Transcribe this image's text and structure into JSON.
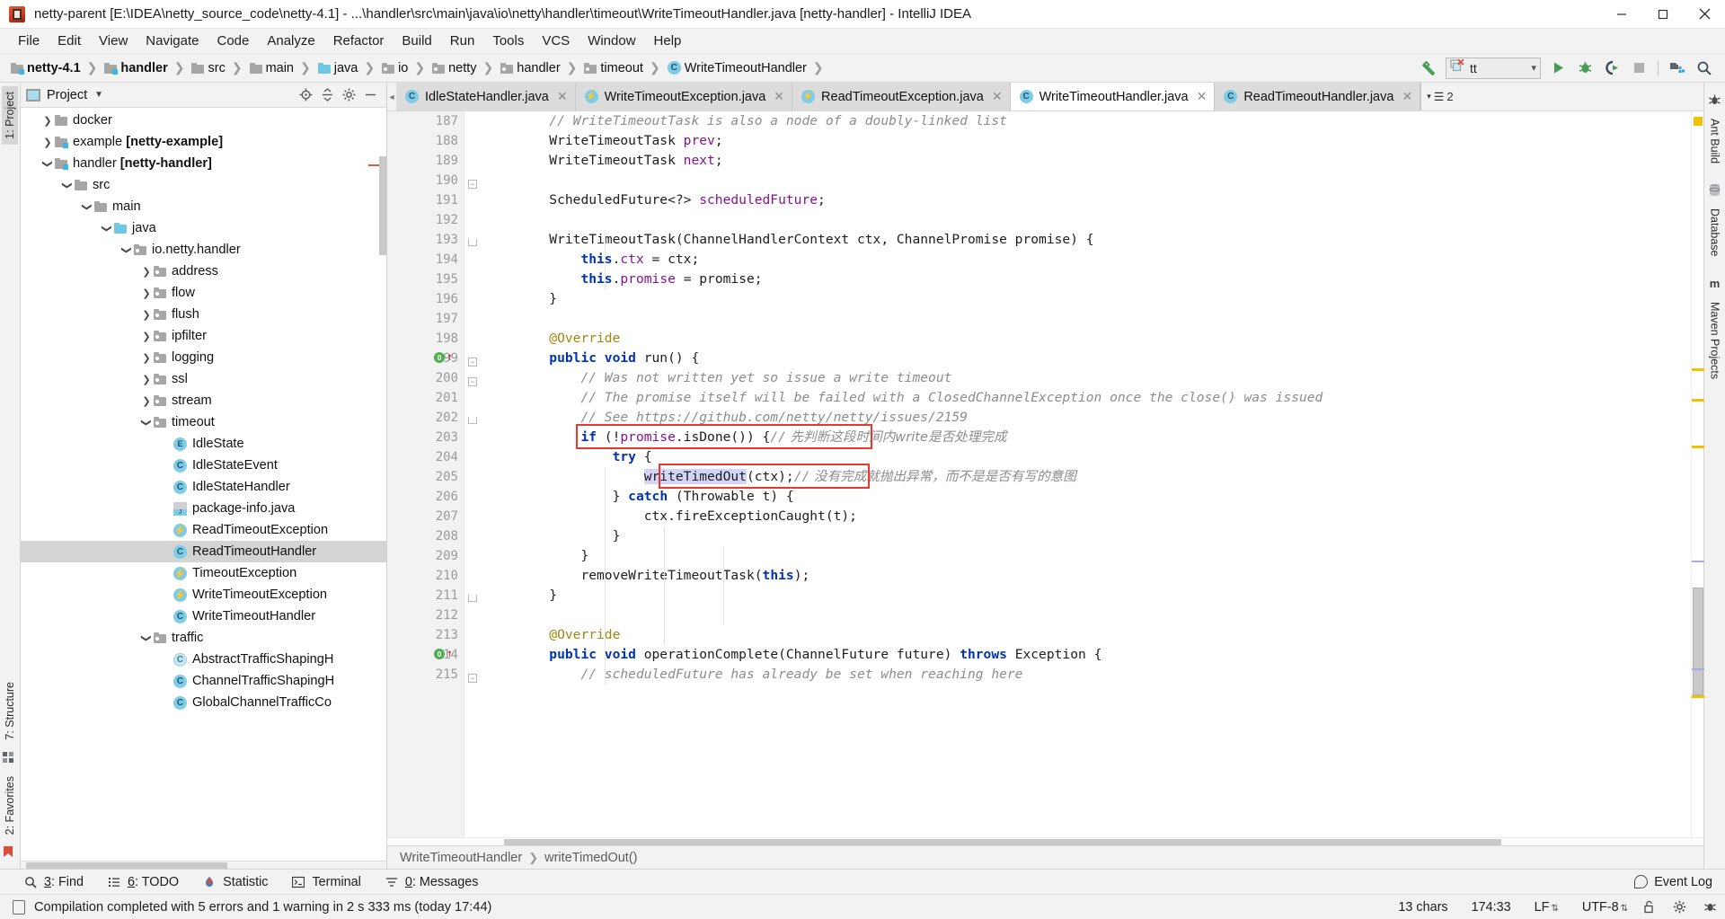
{
  "window": {
    "title": "netty-parent [E:\\IDEA\\netty_source_code\\netty-4.1] - ...\\handler\\src\\main\\java\\io\\netty\\handler\\timeout\\WriteTimeoutHandler.java [netty-handler] - IntelliJ IDEA",
    "minimize_label": "minimize-icon",
    "maximize_label": "maximize-icon",
    "close_label": "close-icon"
  },
  "menubar": {
    "items": [
      "File",
      "Edit",
      "View",
      "Navigate",
      "Code",
      "Analyze",
      "Refactor",
      "Build",
      "Run",
      "Tools",
      "VCS",
      "Window",
      "Help"
    ]
  },
  "navbar": {
    "breadcrumbs": [
      {
        "label": "netty-4.1",
        "icon": "module-folder-icon",
        "bold": true
      },
      {
        "label": "handler",
        "icon": "module-folder-icon",
        "bold": true
      },
      {
        "label": "src",
        "icon": "folder-icon",
        "bold": false
      },
      {
        "label": "main",
        "icon": "folder-icon",
        "bold": false
      },
      {
        "label": "java",
        "icon": "source-folder-icon",
        "bold": false
      },
      {
        "label": "io",
        "icon": "package-icon",
        "bold": false
      },
      {
        "label": "netty",
        "icon": "package-icon",
        "bold": false
      },
      {
        "label": "handler",
        "icon": "package-icon",
        "bold": false
      },
      {
        "label": "timeout",
        "icon": "package-icon",
        "bold": false
      },
      {
        "label": "WriteTimeoutHandler",
        "icon": "class-icon",
        "bold": false
      }
    ],
    "run_config": "tt",
    "buttons": [
      "build-hammer-icon",
      "run-icon",
      "debug-icon",
      "run-with-coverage-icon",
      "stop-icon",
      "project-structure-icon",
      "search-everywhere-icon"
    ]
  },
  "project_panel": {
    "title": "Project",
    "header_buttons": [
      "locate-icon",
      "collapse-all-icon",
      "settings-gear-icon",
      "hide-icon"
    ],
    "tree": [
      {
        "label": "docker",
        "indent": 1,
        "twist": "collapsed",
        "icon": "folder-icon",
        "selected": false
      },
      {
        "label": "example ",
        "bold_suffix": "[netty-example]",
        "indent": 1,
        "twist": "collapsed",
        "icon": "module-folder-icon",
        "selected": false
      },
      {
        "label": "handler ",
        "bold_suffix": "[netty-handler]",
        "indent": 1,
        "twist": "expanded",
        "icon": "module-folder-icon",
        "selected": false
      },
      {
        "label": "src",
        "indent": 2,
        "twist": "expanded",
        "icon": "folder-icon",
        "selected": false
      },
      {
        "label": "main",
        "indent": 3,
        "twist": "expanded",
        "icon": "folder-icon",
        "selected": false
      },
      {
        "label": "java",
        "indent": 4,
        "twist": "expanded",
        "icon": "source-folder-icon",
        "selected": false
      },
      {
        "label": "io.netty.handler",
        "indent": 5,
        "twist": "expanded",
        "icon": "package-icon",
        "selected": false
      },
      {
        "label": "address",
        "indent": 6,
        "twist": "collapsed",
        "icon": "package-icon",
        "selected": false
      },
      {
        "label": "flow",
        "indent": 6,
        "twist": "collapsed",
        "icon": "package-icon",
        "selected": false
      },
      {
        "label": "flush",
        "indent": 6,
        "twist": "collapsed",
        "icon": "package-icon",
        "selected": false
      },
      {
        "label": "ipfilter",
        "indent": 6,
        "twist": "collapsed",
        "icon": "package-icon",
        "selected": false
      },
      {
        "label": "logging",
        "indent": 6,
        "twist": "collapsed",
        "icon": "package-icon",
        "selected": false
      },
      {
        "label": "ssl",
        "indent": 6,
        "twist": "collapsed",
        "icon": "package-icon",
        "selected": false
      },
      {
        "label": "stream",
        "indent": 6,
        "twist": "collapsed",
        "icon": "package-icon",
        "selected": false
      },
      {
        "label": "timeout",
        "indent": 6,
        "twist": "expanded",
        "icon": "package-icon",
        "selected": false
      },
      {
        "label": "IdleState",
        "indent": 7,
        "twist": "none",
        "icon": "enum-icon",
        "selected": false
      },
      {
        "label": "IdleStateEvent",
        "indent": 7,
        "twist": "none",
        "icon": "class-icon",
        "selected": false
      },
      {
        "label": "IdleStateHandler",
        "indent": 7,
        "twist": "none",
        "icon": "class-icon",
        "selected": false
      },
      {
        "label": "package-info.java",
        "indent": 7,
        "twist": "none",
        "icon": "java-file-icon",
        "selected": false
      },
      {
        "label": "ReadTimeoutException",
        "indent": 7,
        "twist": "none",
        "icon": "exception-class-icon",
        "selected": false
      },
      {
        "label": "ReadTimeoutHandler",
        "indent": 7,
        "twist": "none",
        "icon": "class-icon",
        "selected": true
      },
      {
        "label": "TimeoutException",
        "indent": 7,
        "twist": "none",
        "icon": "exception-icon",
        "selected": false
      },
      {
        "label": "WriteTimeoutException",
        "indent": 7,
        "twist": "none",
        "icon": "exception-class-icon",
        "selected": false
      },
      {
        "label": "WriteTimeoutHandler",
        "indent": 7,
        "twist": "none",
        "icon": "class-icon",
        "selected": false
      },
      {
        "label": "traffic",
        "indent": 6,
        "twist": "expanded",
        "icon": "package-icon",
        "selected": false
      },
      {
        "label": "AbstractTrafficShapingH",
        "indent": 7,
        "twist": "none",
        "icon": "abstract-class-icon",
        "selected": false
      },
      {
        "label": "ChannelTrafficShapingH",
        "indent": 7,
        "twist": "none",
        "icon": "class-icon",
        "selected": false
      },
      {
        "label": "GlobalChannelTrafficCo",
        "indent": 7,
        "twist": "none",
        "icon": "class-icon",
        "selected": false
      }
    ]
  },
  "left_strip": {
    "top_tabs": [
      "1: Project"
    ],
    "bottom_tabs": [
      "7: Structure",
      "2: Favorites"
    ]
  },
  "right_strip": {
    "tabs": [
      "Ant Build",
      "Database",
      "Maven Projects"
    ]
  },
  "editor_tabs": [
    {
      "label": "IdleStateHandler.java",
      "icon": "class-icon",
      "active": false
    },
    {
      "label": "WriteTimeoutException.java",
      "icon": "exception-class-icon",
      "active": false
    },
    {
      "label": "ReadTimeoutException.java",
      "icon": "exception-class-icon",
      "active": false
    },
    {
      "label": "WriteTimeoutHandler.java",
      "icon": "class-icon",
      "active": true
    },
    {
      "label": "ReadTimeoutHandler.java",
      "icon": "class-icon",
      "active": false
    }
  ],
  "editor_tabs_overflow": "2",
  "code": {
    "first_line": 187,
    "lines": [
      {
        "n": 187,
        "html": "        <span class='cm'>// WriteTimeoutTask is also a node of a doubly-linked list</span>"
      },
      {
        "n": 188,
        "html": "        <span class='tx'>WriteTimeoutTask </span><span class='fl'>prev</span><span class='tx'>;</span>"
      },
      {
        "n": 189,
        "html": "        <span class='tx'>WriteTimeoutTask </span><span class='fl'>next</span><span class='tx'>;</span>"
      },
      {
        "n": 190,
        "html": ""
      },
      {
        "n": 191,
        "html": "        <span class='tx'>ScheduledFuture&lt;?&gt; </span><span class='fl'>scheduledFuture</span><span class='tx'>;</span>"
      },
      {
        "n": 192,
        "html": ""
      },
      {
        "n": 193,
        "html": "        <span class='tx'>WriteTimeoutTask(ChannelHandlerContext ctx, ChannelPromise promise) {</span>"
      },
      {
        "n": 194,
        "html": "            <span class='k'>this</span><span class='tx'>.</span><span class='fl'>ctx</span><span class='tx'> = ctx;</span>"
      },
      {
        "n": 195,
        "html": "            <span class='k'>this</span><span class='tx'>.</span><span class='fl'>promise</span><span class='tx'> = promise;</span>"
      },
      {
        "n": 196,
        "html": "        <span class='tx'>}</span>"
      },
      {
        "n": 197,
        "html": ""
      },
      {
        "n": 198,
        "html": "        <span class='an'>@Override</span>"
      },
      {
        "n": 199,
        "html": "        <span class='k'>public void </span><span class='tx'>run() {</span>"
      },
      {
        "n": 200,
        "html": "            <span class='cm'>// Was not written yet so issue a write timeout</span>"
      },
      {
        "n": 201,
        "html": "            <span class='cm'>// The promise itself will be failed with a ClosedChannelException once the close() was issued</span>"
      },
      {
        "n": 202,
        "html": "            <span class='cm'>// See https://github.com/netty/netty/issues/2159</span>"
      },
      {
        "n": 203,
        "html": "            <span class='k'>if </span><span class='tx'>(!</span><span class='fl'>promise</span><span class='tx'>.isDone()) {</span><span class='cm'>//</span><span class='cnzh'> 先判断这段时间内write是否处理完成</span>"
      },
      {
        "n": 204,
        "html": "                <span class='k'>try </span><span class='tx'>{</span>"
      },
      {
        "n": 205,
        "html": "                    <span class='selhl'>writeTimedOut</span><span class='tx'>(ctx);</span><span class='cm'>//</span><span class='cnzh'> 没有完成就抛出异常，而不是是否有写的意图</span>"
      },
      {
        "n": 206,
        "html": "                <span class='tx'>} </span><span class='k'>catch </span><span class='tx'>(Throwable t) {</span>"
      },
      {
        "n": 207,
        "html": "                    <span class='tx'>ctx.fireExceptionCaught(t);</span>"
      },
      {
        "n": 208,
        "html": "                <span class='tx'>}</span>"
      },
      {
        "n": 209,
        "html": "            <span class='tx'>}</span>"
      },
      {
        "n": 210,
        "html": "            <span class='tx'>removeWriteTimeoutTask(</span><span class='k'>this</span><span class='tx'>);</span>"
      },
      {
        "n": 211,
        "html": "        <span class='tx'>}</span>"
      },
      {
        "n": 212,
        "html": ""
      },
      {
        "n": 213,
        "html": "        <span class='an'>@Override</span>"
      },
      {
        "n": 214,
        "html": "        <span class='k'>public void </span><span class='tx'>operationComplete(ChannelFuture future) </span><span class='k'>throws </span><span class='tx'>Exception {</span>"
      },
      {
        "n": 215,
        "html": "            <span class='cm'>// scheduledFuture has already be set when reaching here</span>"
      }
    ],
    "gutter_markers": [
      {
        "line": 199,
        "icon": "overridden-method-icon",
        "glyph": "O"
      },
      {
        "line": 214,
        "icon": "overridden-method-icon",
        "glyph": "O"
      }
    ]
  },
  "breadcrumb_bottom": {
    "class_name": "WriteTimeoutHandler",
    "method_name": "writeTimedOut()"
  },
  "tool_window_bar": {
    "items": [
      {
        "num": "3",
        "label": "Find",
        "icon": "search-icon"
      },
      {
        "num": "6",
        "label": "TODO",
        "icon": "todo-list-icon"
      },
      {
        "num": "",
        "label": "Statistic",
        "icon": "statistic-icon"
      },
      {
        "num": "",
        "label": "Terminal",
        "icon": "terminal-icon"
      },
      {
        "num": "0",
        "label": "Messages",
        "icon": "messages-icon"
      }
    ],
    "event_log": "Event Log"
  },
  "status_bar": {
    "message": "Compilation completed with 5 errors and 1 warning in 2 s 333 ms (today 17:44)",
    "chars": "13 chars",
    "caret": "174:33",
    "line_sep": "LF",
    "encoding": "UTF-8",
    "icons": [
      "lock-icon",
      "gear-icon",
      "inspections-icon"
    ]
  },
  "colors": {
    "accent_blue": "#7ecbe8",
    "highlight_red": "#e8382b",
    "error_red": "#e05b4b",
    "warning_yellow": "#f2c200",
    "green": "#4caf50",
    "selection": "#d4d4f7"
  }
}
